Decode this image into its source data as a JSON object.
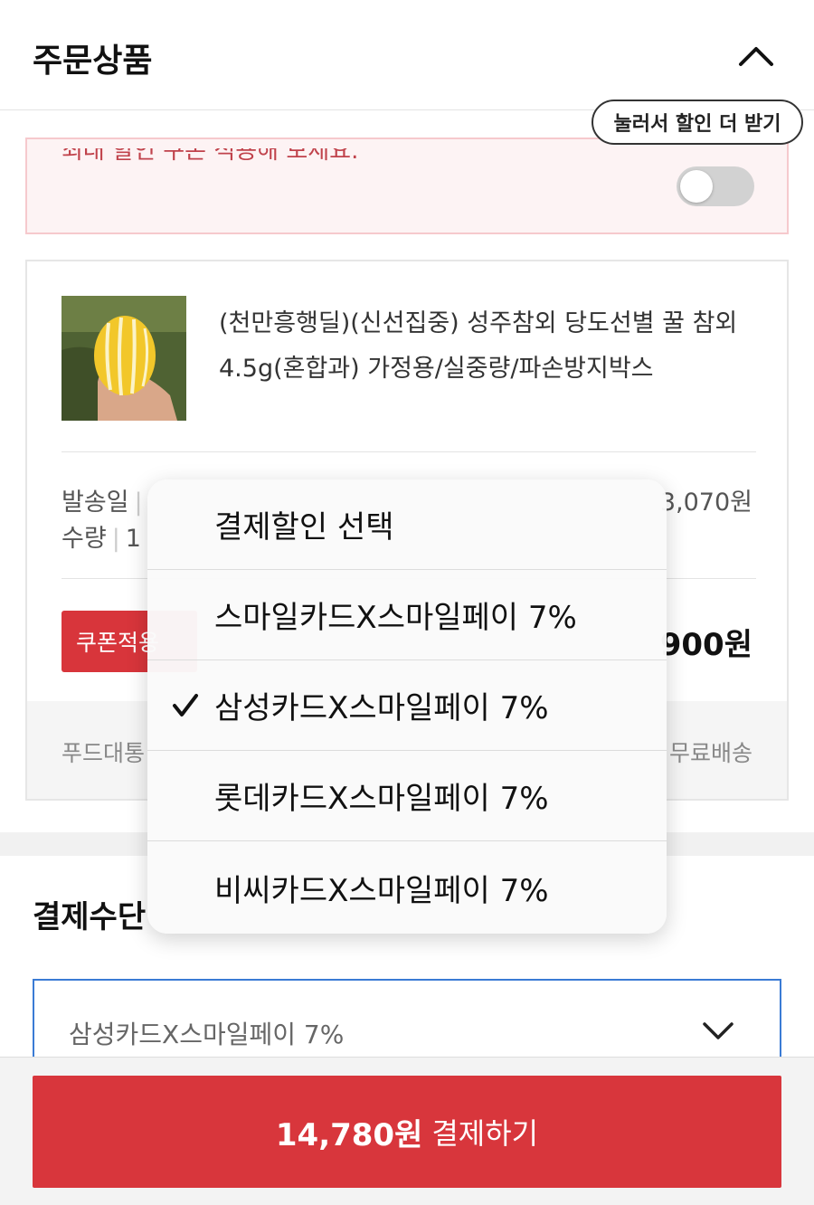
{
  "header": {
    "title": "주문상품",
    "collapse_icon": "chevron-up-icon"
  },
  "coupon_banner": {
    "cut_text": "최대 할인 쿠폰 적용해 보세요.",
    "tooltip": "눌러서 할인 더 받기",
    "toggle_on": false
  },
  "product": {
    "name": "(천만흥행딜)(신선집중) 성주참외 당도선별 꿀 참외 4.5g(혼합과) 가정용/실중량/파손방지박스",
    "ship_label": "발송일",
    "ship_value": "",
    "qty_label": "수량",
    "qty_value": "1",
    "orig_price": "3,070원",
    "coupon_button": "쿠폰적용",
    "total_price": "900원",
    "delivery_left": "푸드대통",
    "delivery_right": "무료배송"
  },
  "payment": {
    "title": "결제수단",
    "selected": "삼성카드X스마일페이 7%",
    "select_icon": "chevron-down-icon"
  },
  "dropdown": {
    "items": [
      {
        "label": "결제할인 선택",
        "checked": false
      },
      {
        "label": "스마일카드X스마일페이 7%",
        "checked": false
      },
      {
        "label": "삼성카드X스마일페이 7%",
        "checked": true
      },
      {
        "label": "롯데카드X스마일페이 7%",
        "checked": false
      },
      {
        "label": "비씨카드X스마일페이 7%",
        "checked": false
      }
    ]
  },
  "pay_button": {
    "amount": "14,780원",
    "label": "결제하기"
  },
  "colors": {
    "accent_red": "#d8363c",
    "banner_bg": "#fdf3f4",
    "select_border": "#3a7bd5"
  }
}
